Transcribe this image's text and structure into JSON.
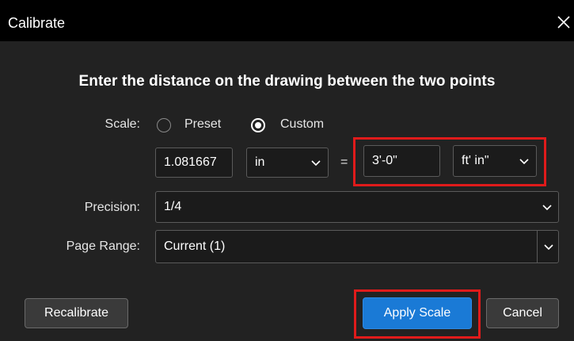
{
  "dialog": {
    "title": "Calibrate"
  },
  "instruction": "Enter the distance on the drawing between the two points",
  "scale": {
    "label": "Scale:",
    "preset_label": "Preset",
    "custom_label": "Custom",
    "selected": "Custom"
  },
  "measure": {
    "drawing_value": "1.081667",
    "drawing_unit": "in",
    "equals": "=",
    "real_value": "3'-0\"",
    "real_unit": "ft' in\""
  },
  "precision": {
    "label": "Precision:",
    "value": "1/4"
  },
  "page_range": {
    "label": "Page Range:",
    "value": "Current (1)"
  },
  "buttons": {
    "recalibrate": "Recalibrate",
    "apply": "Apply Scale",
    "cancel": "Cancel"
  },
  "colors": {
    "background": "#222222",
    "titlebar": "#000000",
    "accent": "#1a7ad6",
    "highlight": "#e01b1b"
  }
}
